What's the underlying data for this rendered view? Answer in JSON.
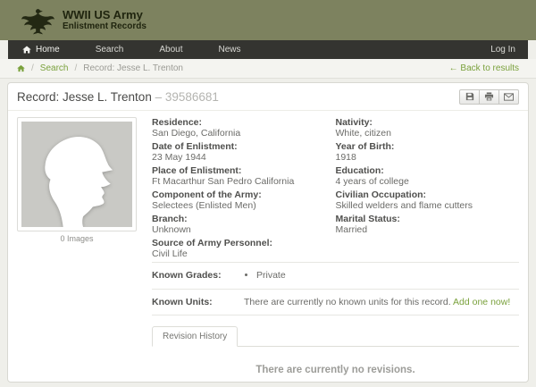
{
  "colors": {
    "header_olive": "#7d825f",
    "navbar_dark": "#343430",
    "accent_green": "#7aa13c"
  },
  "header": {
    "site_title": "WWII US Army",
    "site_subtitle": "Enlistment Records"
  },
  "nav": {
    "home": "Home",
    "search": "Search",
    "about": "About",
    "news": "News",
    "login": "Log In"
  },
  "breadcrumb": {
    "separator": "/",
    "search": "Search",
    "current": "Record: Jesse L. Trenton",
    "back": "← Back to results"
  },
  "record": {
    "title": "Record: Jesse L. Trenton",
    "number": "– 39586681",
    "images_caption": "0 Images",
    "fields_left": [
      {
        "label": "Residence:",
        "value": "San Diego, California"
      },
      {
        "label": "Date of Enlistment:",
        "value": "23 May 1944"
      },
      {
        "label": "Place of Enlistment:",
        "value": "Ft Macarthur San Pedro California"
      },
      {
        "label": "Component of the Army:",
        "value": "Selectees (Enlisted Men)"
      },
      {
        "label": "Branch:",
        "value": "Unknown"
      },
      {
        "label": "Source of Army Personnel:",
        "value": "Civil Life"
      }
    ],
    "fields_right": [
      {
        "label": "Nativity:",
        "value": "White, citizen"
      },
      {
        "label": "Year of Birth:",
        "value": "1918"
      },
      {
        "label": "Education:",
        "value": "4 years of college"
      },
      {
        "label": "Civilian Occupation:",
        "value": "Skilled welders and flame cutters"
      },
      {
        "label": "Marital Status:",
        "value": "Married"
      }
    ],
    "known_grades": {
      "label": "Known Grades:",
      "items": [
        "Private"
      ]
    },
    "known_units": {
      "label": "Known Units:",
      "text": "There are currently no known units for this record.",
      "link": "Add one now!"
    },
    "revision_tab": "Revision History",
    "no_revisions": "There are currently no revisions."
  }
}
